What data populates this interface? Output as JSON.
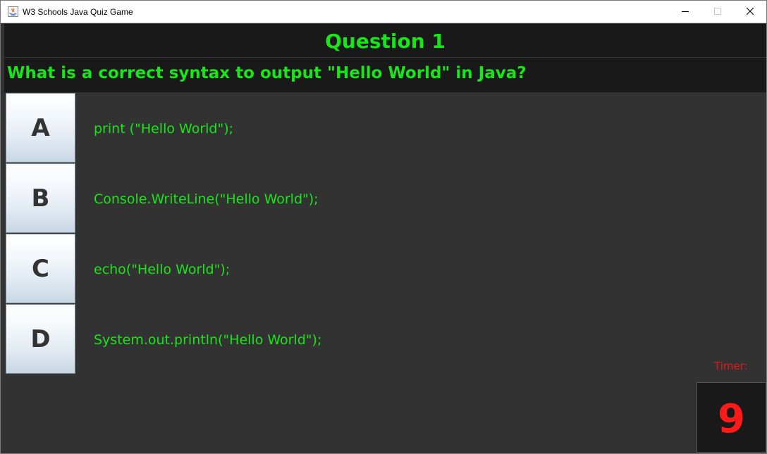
{
  "window": {
    "title": "W3 Schools Java Quiz Game"
  },
  "question": {
    "header": "Question 1",
    "text": "What is a correct syntax to output \"Hello World\" in Java?"
  },
  "answers": [
    {
      "letter": "A",
      "text": "print (\"Hello World\");"
    },
    {
      "letter": "B",
      "text": "Console.WriteLine(\"Hello World\");"
    },
    {
      "letter": "C",
      "text": "echo(\"Hello World\");"
    },
    {
      "letter": "D",
      "text": "System.out.println(\"Hello World\");"
    }
  ],
  "timer": {
    "label": "Timer:",
    "value": "9"
  },
  "icons": {
    "app": "java-app-icon",
    "minimize": "minimize-icon",
    "maximize": "maximize-icon",
    "close": "close-icon"
  },
  "colors": {
    "text_green": "#19e619",
    "timer_red": "#ff1a1a",
    "background": "#323232",
    "header_background": "#191919"
  }
}
